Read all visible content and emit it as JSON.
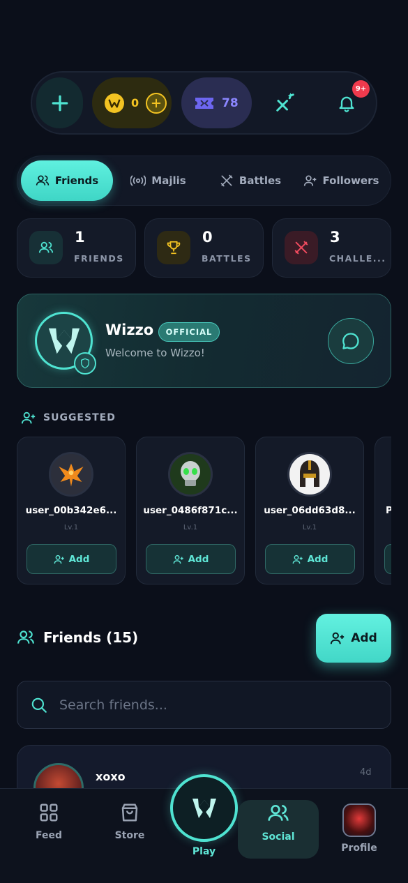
{
  "topbar": {
    "coins": "0",
    "tickets": "78",
    "notification_count": "9+"
  },
  "tabs": [
    {
      "label": "Friends",
      "active": true
    },
    {
      "label": "Majlis",
      "active": false
    },
    {
      "label": "Battles",
      "active": false
    },
    {
      "label": "Followers",
      "active": false
    }
  ],
  "stats": [
    {
      "value": "1",
      "label": "FRIENDS"
    },
    {
      "value": "0",
      "label": "BATTLES"
    },
    {
      "value": "3",
      "label": "CHALLE..."
    }
  ],
  "official": {
    "name": "Wizzo",
    "badge": "OFFICIAL",
    "subtitle": "Welcome to Wizzo!"
  },
  "suggested": {
    "heading": "SUGGESTED",
    "users": [
      {
        "name": "user_00b342e6...",
        "level": "Lv.1",
        "add_label": "Add"
      },
      {
        "name": "user_0486f871c...",
        "level": "Lv.1",
        "add_label": "Add"
      },
      {
        "name": "user_06dd63d8...",
        "level": "Lv.1",
        "add_label": "Add"
      },
      {
        "name": "P",
        "level": "",
        "add_label": ""
      }
    ]
  },
  "friends": {
    "title": "Friends (15)",
    "add_label": "Add",
    "search_placeholder": "Search friends...",
    "list": [
      {
        "name": "xoxo",
        "time": "4d"
      }
    ]
  },
  "nav": {
    "feed": "Feed",
    "store": "Store",
    "play": "Play",
    "social": "Social",
    "profile": "Profile"
  },
  "colors": {
    "accent": "#4fe3d1",
    "coin": "#f3c322",
    "ticket": "#8b86ff",
    "badge": "#ef3a4d",
    "background": "#0b0f1a"
  }
}
